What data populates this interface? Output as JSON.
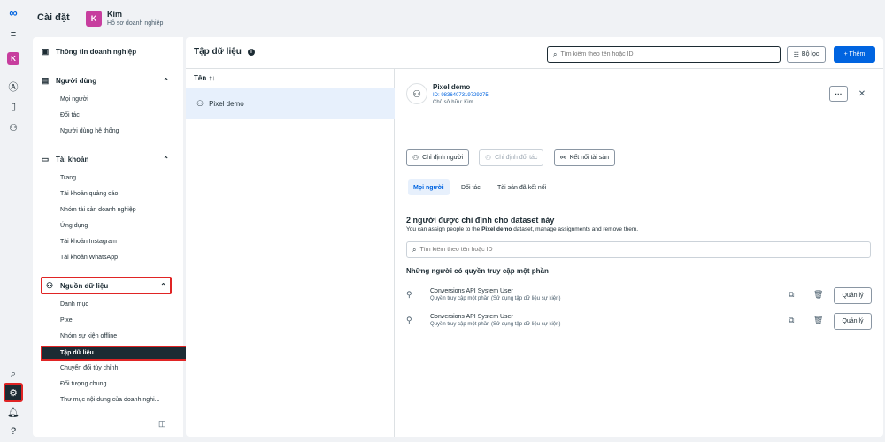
{
  "rail": {
    "avatar": "K"
  },
  "header": {
    "title": "Cài đặt",
    "account_initial": "K",
    "account_name": "Kim",
    "account_sub": "Hồ sơ doanh nghiệp"
  },
  "sidebar": {
    "business_info": "Thông tin doanh nghiệp",
    "users": {
      "label": "Người dùng",
      "items": [
        "Mọi người",
        "Đối tác",
        "Người dùng hệ thống"
      ]
    },
    "accounts": {
      "label": "Tài khoản",
      "items": [
        "Trang",
        "Tài khoản quảng cáo",
        "Nhóm tài sản doanh nghiệp",
        "Ứng dụng",
        "Tài khoản Instagram",
        "Tài khoản WhatsApp"
      ]
    },
    "data_sources": {
      "label": "Nguồn dữ liệu",
      "items": [
        "Danh mục",
        "Pixel",
        "Nhóm sự kiện offline",
        "Tập dữ liệu",
        "Chuyển đổi tùy chỉnh",
        "Đối tượng chung",
        "Thư mục nội dung của doanh nghi..."
      ]
    }
  },
  "main": {
    "title": "Tập dữ liệu",
    "search_placeholder": "Tìm kiếm theo tên hoặc ID",
    "filter_label": "Bộ lọc",
    "add_label": "+ Thêm",
    "list_header": "Tên ↑↓",
    "list_items": [
      "Pixel demo"
    ]
  },
  "detail": {
    "name": "Pixel demo",
    "id_text": "ID: 9836407319729275",
    "owner": "Chủ sở hữu: Kim",
    "more_label": "···",
    "buttons": {
      "assign_people": "Chỉ định người",
      "assign_partner": "Chỉ định đối tác",
      "connect_assets": "Kết nối tài sản"
    },
    "tabs": [
      "Mọi người",
      "Đối tác",
      "Tài sản đã kết nối"
    ],
    "heading": "2 người được chỉ định cho dataset này",
    "desc_before": "You can assign people to the ",
    "desc_bold": "Pixel demo",
    "desc_after": " dataset, manage assignments and remove them.",
    "search_placeholder": "Tìm kiếm theo tên hoặc ID",
    "partial_access_heading": "Những người có quyền truy cập một phần",
    "users": [
      {
        "name": "Conversions API System User",
        "access": "Quyền truy cập một phần (Sử dụng tập dữ liệu sự kiện)",
        "manage_label": "Quản lý"
      },
      {
        "name": "Conversions API System User",
        "access": "Quyền truy cập một phần (Sử dụng tập dữ liệu sự kiện)",
        "manage_label": "Quản lý"
      }
    ]
  }
}
